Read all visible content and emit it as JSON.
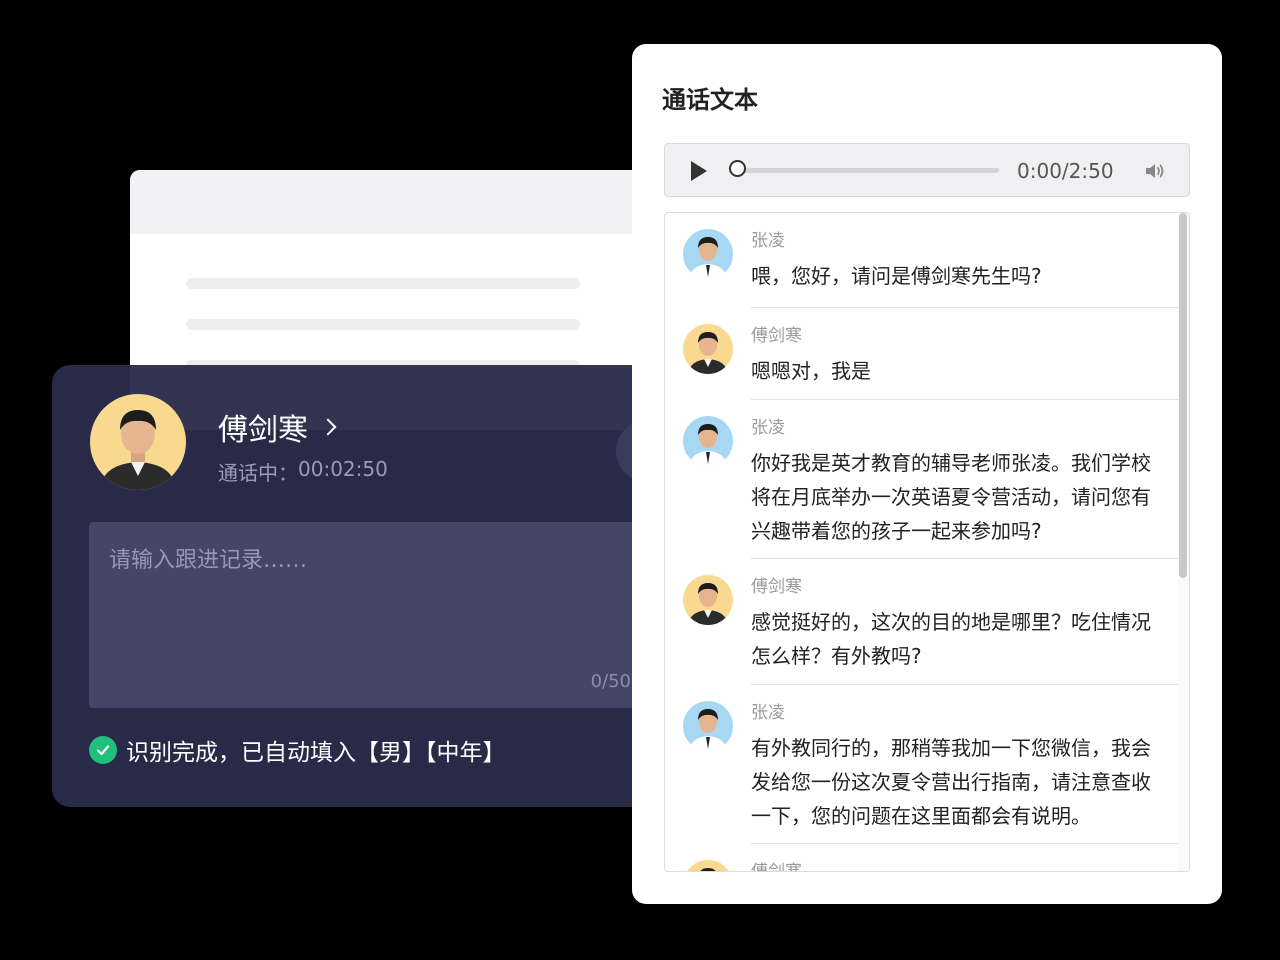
{
  "call": {
    "name": "傅剑寒",
    "status_label": "通话中：",
    "duration": "00:02:50",
    "note_placeholder": "请输入跟进记录……",
    "note_count": "0/50",
    "recognition": "识别完成，已自动填入【男】【中年】"
  },
  "transcript": {
    "title": "通话文本",
    "player": {
      "time": "0:00/2:50",
      "progress": 0
    },
    "messages": [
      {
        "speaker": "张凌",
        "avatar": "agent",
        "text": "喂，您好，请问是傅剑寒先生吗?"
      },
      {
        "speaker": "傅剑寒",
        "avatar": "customer",
        "text": "嗯嗯对，我是"
      },
      {
        "speaker": "张凌",
        "avatar": "agent",
        "text": "你好我是英才教育的辅导老师张凌。我们学校将在月底举办一次英语夏令营活动，请问您有兴趣带着您的孩子一起来参加吗?"
      },
      {
        "speaker": "傅剑寒",
        "avatar": "customer",
        "text": "感觉挺好的，这次的目的地是哪里？吃住情况怎么样？有外教吗?"
      },
      {
        "speaker": "张凌",
        "avatar": "agent",
        "text": "有外教同行的，那稍等我加一下您微信，我会发给您一份这次夏令营出行指南，请注意查收一下，您的问题在这里面都会有说明。"
      },
      {
        "speaker": "傅剑寒",
        "avatar": "customer",
        "text": ""
      }
    ]
  },
  "colors": {
    "success": "#1fc07a",
    "card_bg": "#2a2c4b",
    "agent_avatar_bg": "#a6d8f3",
    "customer_avatar_bg": "#f8d98f"
  },
  "icons": {
    "play": "play-icon",
    "volume": "volume-icon",
    "check": "check-circle-icon",
    "chevron": "chevron-right-icon"
  }
}
